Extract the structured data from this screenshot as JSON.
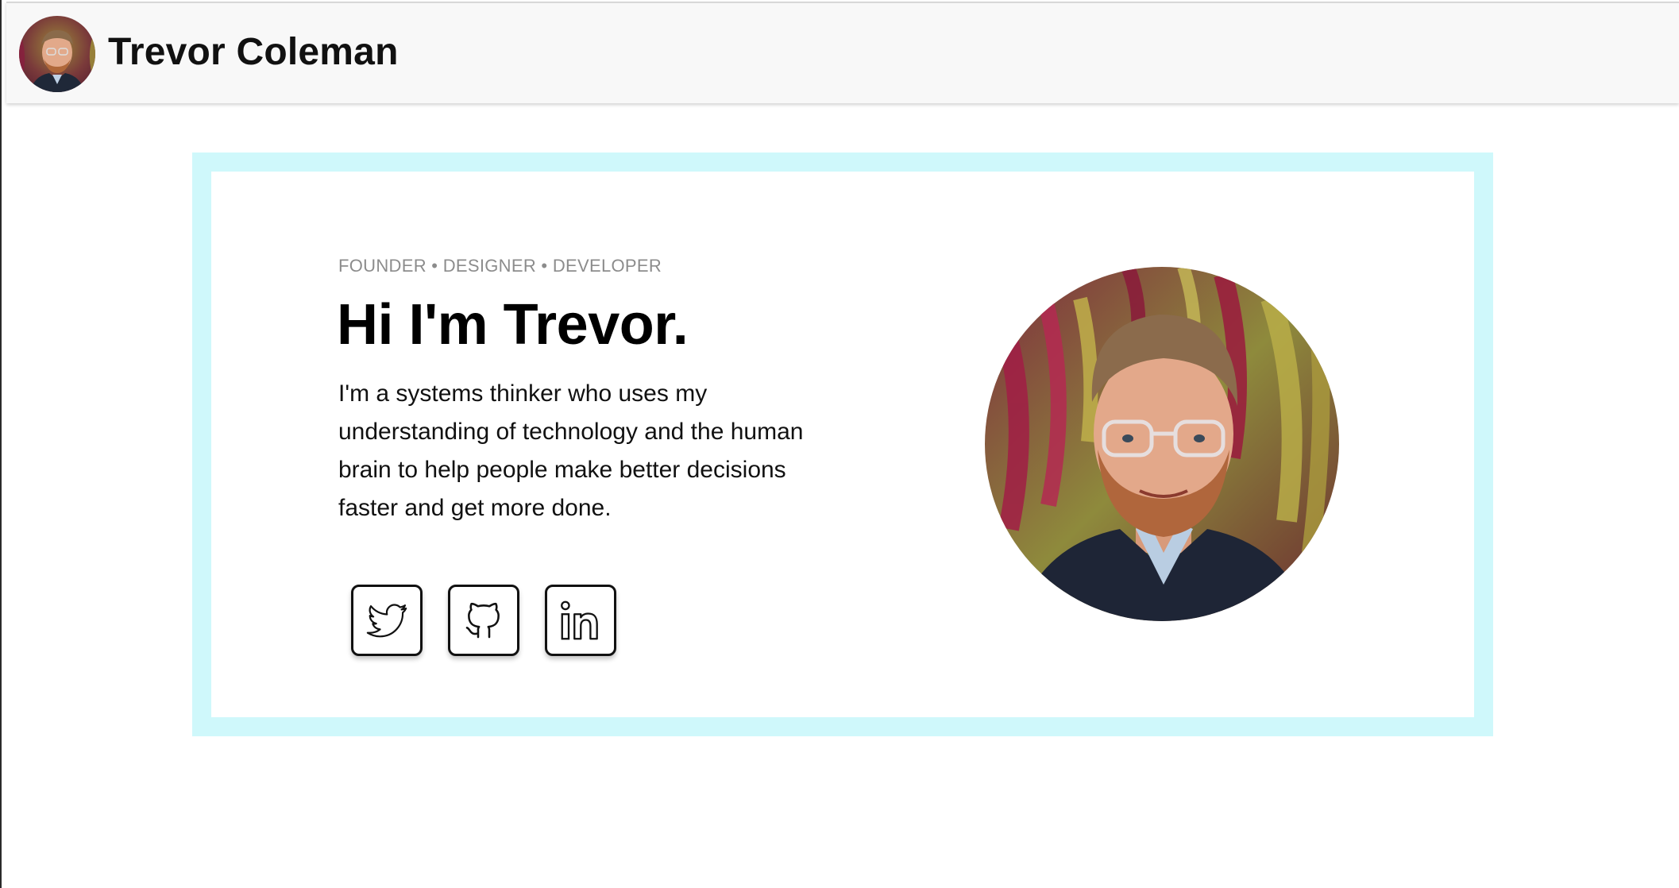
{
  "header": {
    "title": "Trevor Coleman",
    "avatar_alt": "Trevor Coleman avatar"
  },
  "hero": {
    "roles": "FOUNDER • DESIGNER • DEVELOPER",
    "greeting": "Hi I'm Trevor.",
    "bio": "I'm a systems thinker who uses my understanding of technology and the human brain to help people make better decisions faster and get more done.",
    "photo_alt": "Portrait of Trevor Coleman"
  },
  "socials": [
    {
      "name": "Twitter",
      "icon": "twitter-icon"
    },
    {
      "name": "GitHub",
      "icon": "github-icon"
    },
    {
      "name": "LinkedIn",
      "icon": "linkedin-icon"
    }
  ],
  "colors": {
    "frame": "#cff8fb",
    "header_bg": "#f8f8f8",
    "text": "#111111",
    "muted": "#8c8c8c"
  }
}
